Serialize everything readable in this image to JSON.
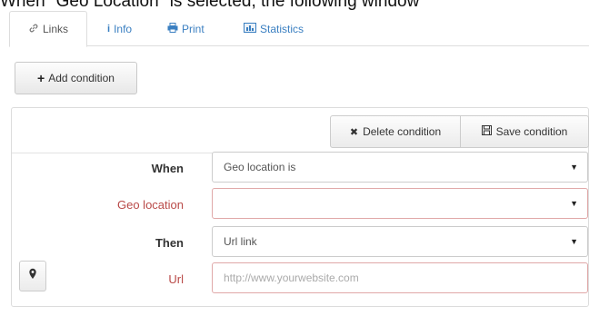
{
  "caption": "When \"Geo Location\" is selected, the following window",
  "tabs": [
    {
      "label": "Links",
      "icon": "link-icon",
      "active": true
    },
    {
      "label": "Info",
      "icon": "info-icon",
      "active": false
    },
    {
      "label": "Print",
      "icon": "print-icon",
      "active": false
    },
    {
      "label": "Statistics",
      "icon": "chart-icon",
      "active": false
    }
  ],
  "add_condition": {
    "label": "Add condition"
  },
  "panel": {
    "delete_label": "Delete condition",
    "save_label": "Save condition",
    "when": {
      "label": "When",
      "value": "Geo location is"
    },
    "geo_location": {
      "label": "Geo location",
      "value": ""
    },
    "then": {
      "label": "Then",
      "value": "Url link"
    },
    "url": {
      "label": "Url",
      "placeholder": "http://www.yourwebsite.com"
    }
  },
  "colors": {
    "link": "#3a7fc1",
    "error": "#b94a48",
    "border": "#cccccc"
  }
}
